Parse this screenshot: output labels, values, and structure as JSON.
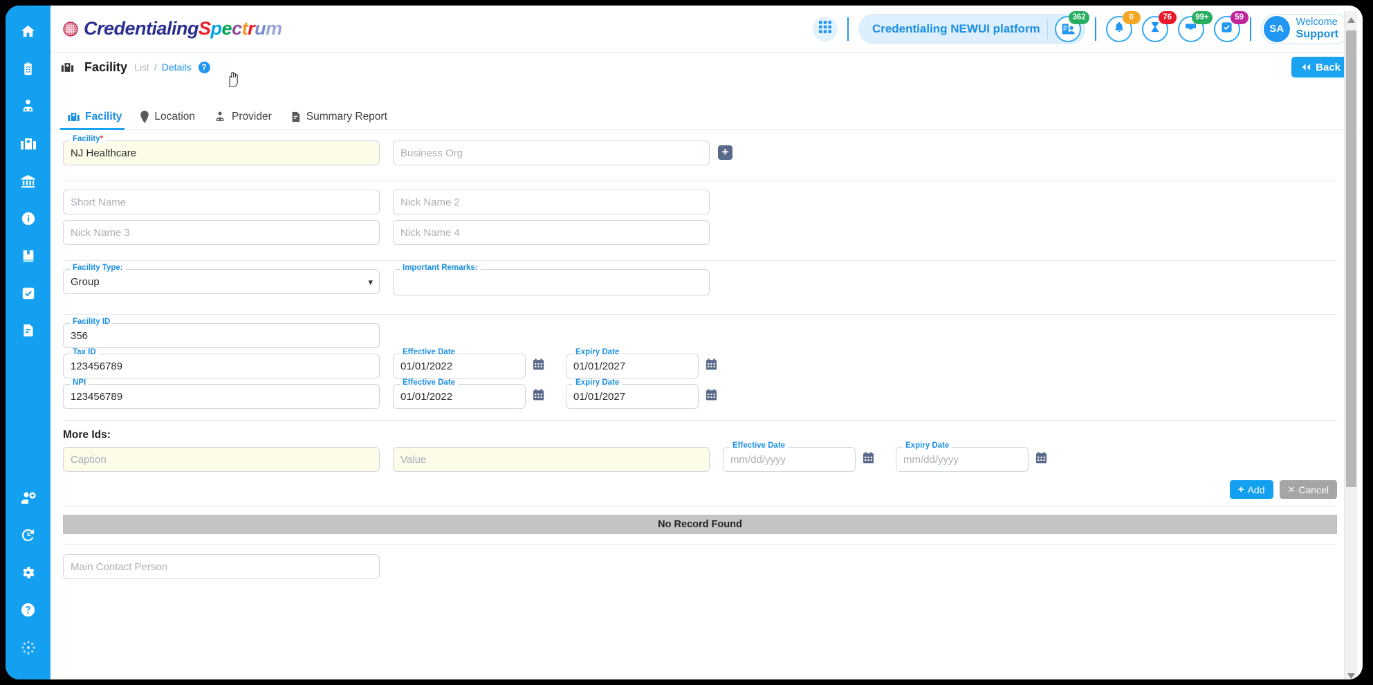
{
  "app": {
    "logo_prefix": "Credentialing",
    "logo_suffix_letters": [
      "S",
      "p",
      "e",
      "c",
      "t",
      "r",
      "u",
      "m"
    ],
    "platform_label": "Credentialing NEWUI platform",
    "platform_badge": "362",
    "grid_icon": "grid-icon",
    "avatar_initials": "SA",
    "welcome_line1": "Welcome",
    "welcome_line2": "Support"
  },
  "notifications": [
    {
      "icon": "bell-icon",
      "count": "0",
      "color": "#f5a623"
    },
    {
      "icon": "hourglass-icon",
      "count": "76",
      "color": "#e8192c"
    },
    {
      "icon": "inbox-icon",
      "count": "99+",
      "color": "#27ae60"
    },
    {
      "icon": "checkbox-icon",
      "count": "59",
      "color": "#c0269b"
    }
  ],
  "breadcrumb": {
    "title": "Facility",
    "list_label": "List",
    "separator": "/",
    "details_label": "Details",
    "help_label": "?",
    "back_label": "Back"
  },
  "tabs": [
    {
      "label": "Facility",
      "icon": "facility-icon",
      "active": true
    },
    {
      "label": "Location",
      "icon": "location-pin-icon",
      "active": false
    },
    {
      "label": "Provider",
      "icon": "provider-icon",
      "active": false
    },
    {
      "label": "Summary Report",
      "icon": "report-icon",
      "active": false
    }
  ],
  "sidebar": {
    "top_items": [
      {
        "name": "home-icon"
      },
      {
        "name": "clipboard-icon"
      },
      {
        "name": "provider-icon"
      },
      {
        "name": "hospital-icon"
      },
      {
        "name": "bank-icon"
      },
      {
        "name": "info-icon"
      },
      {
        "name": "book-icon"
      },
      {
        "name": "check-icon"
      },
      {
        "name": "document-icon"
      }
    ],
    "bottom_items": [
      {
        "name": "user-settings-icon"
      },
      {
        "name": "history-icon"
      },
      {
        "name": "gear-icon"
      },
      {
        "name": "help-icon"
      },
      {
        "name": "spinner-icon"
      }
    ]
  },
  "form": {
    "facility": {
      "label": "Facility",
      "required": "*",
      "value": "NJ Healthcare"
    },
    "business_org": {
      "placeholder": "Business Org",
      "value": ""
    },
    "add_org_button": "+",
    "short_name": {
      "placeholder": "Short Name",
      "value": ""
    },
    "nick_name_2": {
      "placeholder": "Nick Name 2",
      "value": ""
    },
    "nick_name_3": {
      "placeholder": "Nick Name 3",
      "value": ""
    },
    "nick_name_4": {
      "placeholder": "Nick Name 4",
      "value": ""
    },
    "facility_type": {
      "label": "Facility Type:",
      "value": "Group",
      "options": [
        "Group"
      ]
    },
    "important_remarks": {
      "label": "Important Remarks:",
      "value": ""
    },
    "facility_id": {
      "label": "Facility ID",
      "value": "356"
    },
    "tax_id": {
      "label": "Tax ID",
      "value": "123456789"
    },
    "tax_effective": {
      "label": "Effective Date",
      "value": "01/01/2022"
    },
    "tax_expiry": {
      "label": "Expiry Date",
      "value": "01/01/2027"
    },
    "npi": {
      "label": "NPI",
      "value": "123456789"
    },
    "npi_effective": {
      "label": "Effective Date",
      "value": "01/01/2022"
    },
    "npi_expiry": {
      "label": "Expiry Date",
      "value": "01/01/2027"
    },
    "more_ids_title": "More Ids:",
    "more_caption": {
      "placeholder": "Caption",
      "value": ""
    },
    "more_value": {
      "placeholder": "Value",
      "value": ""
    },
    "more_effective": {
      "label": "Effective Date",
      "placeholder": "mm/dd/yyyy",
      "value": ""
    },
    "more_expiry": {
      "label": "Expiry Date",
      "placeholder": "mm/dd/yyyy",
      "value": ""
    },
    "add_label": "Add",
    "cancel_label": "Cancel",
    "no_record": "No Record Found",
    "main_contact": {
      "placeholder": "Main Contact Person",
      "value": ""
    }
  },
  "colors": {
    "brand_blue": "#14a0f0",
    "sidebar_blue": "#14a0f0",
    "label_blue": "#1a8fe3",
    "cream_field": "#fcfce9",
    "norecord_gray": "#c4c4c4"
  }
}
